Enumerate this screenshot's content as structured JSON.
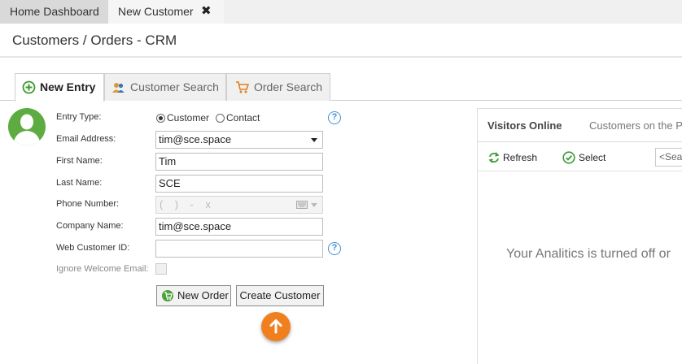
{
  "doc_tabs": [
    {
      "label": "Home Dashboard"
    },
    {
      "label": "New Customer",
      "close": "✖"
    }
  ],
  "page_title": "Customers / Orders - CRM",
  "entry_tabs": [
    {
      "label": "New Entry",
      "icon": "plus-circle-icon"
    },
    {
      "label": "Customer Search",
      "icon": "people-icon"
    },
    {
      "label": "Order Search",
      "icon": "cart-icon"
    }
  ],
  "form": {
    "entry_type": {
      "label": "Entry Type:",
      "options": [
        "Customer",
        "Contact"
      ],
      "selected": "Customer"
    },
    "email": {
      "label": "Email Address:",
      "value": "tim@sce.space"
    },
    "first_name": {
      "label": "First Name:",
      "value": "Tim"
    },
    "last_name": {
      "label": "Last Name:",
      "value": "SCE"
    },
    "phone": {
      "label": "Phone Number:",
      "value": "(    )    -    x"
    },
    "company": {
      "label": "Company Name:",
      "value": "tim@sce.space"
    },
    "web_id": {
      "label": "Web Customer ID:",
      "value": ""
    },
    "ignore_welcome": {
      "label": "Ignore Welcome Email:",
      "checked": false
    },
    "help_glyph": "?"
  },
  "buttons": {
    "new_order": "New Order",
    "create_customer": "Create Customer"
  },
  "visitors": {
    "title": "Visitors Online",
    "subtitle": "Customers on the P",
    "refresh": "Refresh",
    "select": "Select",
    "search_placeholder": "<Sea",
    "message": "Your Analitics is turned off or"
  },
  "colors": {
    "accent_green": "#5dab41",
    "accent_orange": "#f07f1e",
    "help_blue": "#3e8fd6"
  }
}
